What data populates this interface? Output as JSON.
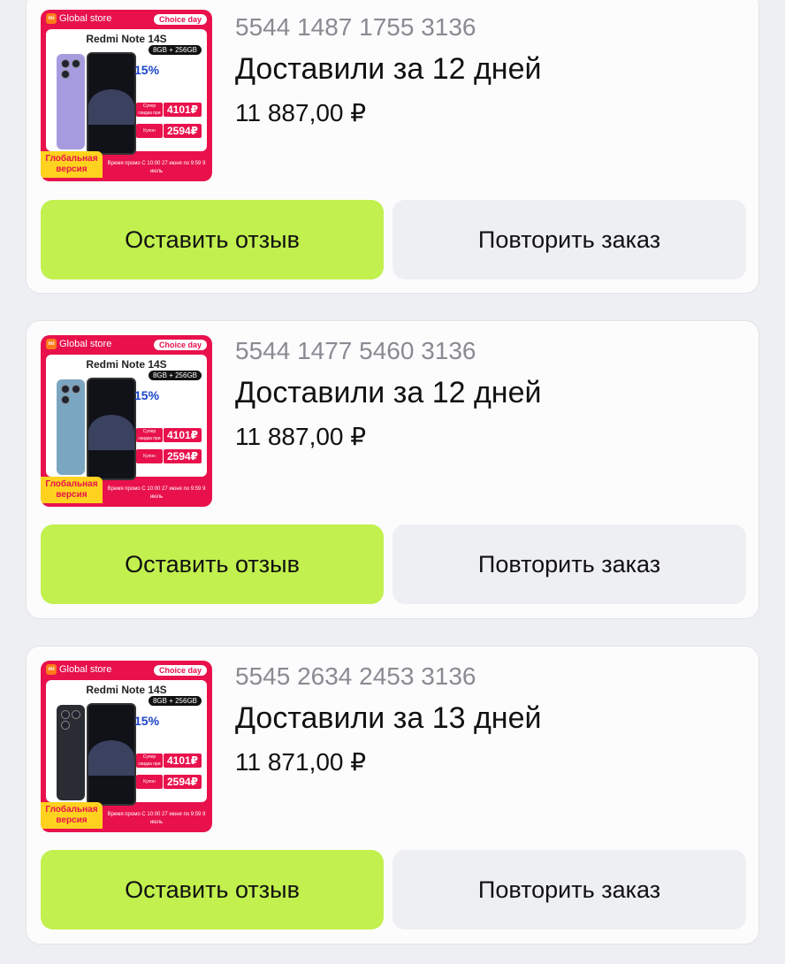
{
  "colors": {
    "page_background": "#eeeff2",
    "card_background": "#fcfcfd",
    "review_button": "#c2f04e",
    "repeat_button": "#eeeff3",
    "promo_red": "#e8114c",
    "promo_yellow": "#ffd21f"
  },
  "orders": [
    {
      "order_number": "5544 1487 1755 3136",
      "delivery": "Доставили за 12 дней",
      "price": "11 887,00 ₽",
      "review_button": "Оставить отзыв",
      "repeat_button": "Повторить заказ",
      "image": {
        "store": "Global store",
        "badge": "Choice day",
        "model": "Redmi Note 14S",
        "memory": "8GB + 256GB",
        "promo": "15%",
        "price_super": "4101₽",
        "price_coupon": "2594₽",
        "label_super": "Супер скидка при оплате",
        "label_coupon": "Купон",
        "global": "Глобальная версия",
        "promo_time": "Время промо С 10:00 27 июня по 9:59 9 июль",
        "phone_color": "#a79be0"
      }
    },
    {
      "order_number": "5544 1477 5460 3136",
      "delivery": "Доставили за 12 дней",
      "price": "11 887,00 ₽",
      "review_button": "Оставить отзыв",
      "repeat_button": "Повторить заказ",
      "image": {
        "store": "Global store",
        "badge": "Choice day",
        "model": "Redmi Note 14S",
        "memory": "8GB + 256GB",
        "promo": "15%",
        "price_super": "4101₽",
        "price_coupon": "2594₽",
        "label_super": "Супер скидка при оплате",
        "label_coupon": "Купон",
        "global": "Глобальная версия",
        "promo_time": "Время промо С 10:00 27 июня по 9:59 9 июль",
        "phone_color": "#7ba6c2"
      }
    },
    {
      "order_number": "5545 2634 2453 3136",
      "delivery": "Доставили за 13 дней",
      "price": "11 871,00 ₽",
      "review_button": "Оставить отзыв",
      "repeat_button": "Повторить заказ",
      "image": {
        "store": "Global store",
        "badge": "Choice day",
        "model": "Redmi Note 14S",
        "memory": "8GB + 256GB",
        "promo": "15%",
        "price_super": "4101₽",
        "price_coupon": "2594₽",
        "label_super": "Супер скидка при оплате",
        "label_coupon": "Купон",
        "global": "Глобальная версия",
        "promo_time": "Время промо С 10:00 27 июня по 9:59 9 июль",
        "phone_color": "#2a2c33"
      }
    }
  ]
}
